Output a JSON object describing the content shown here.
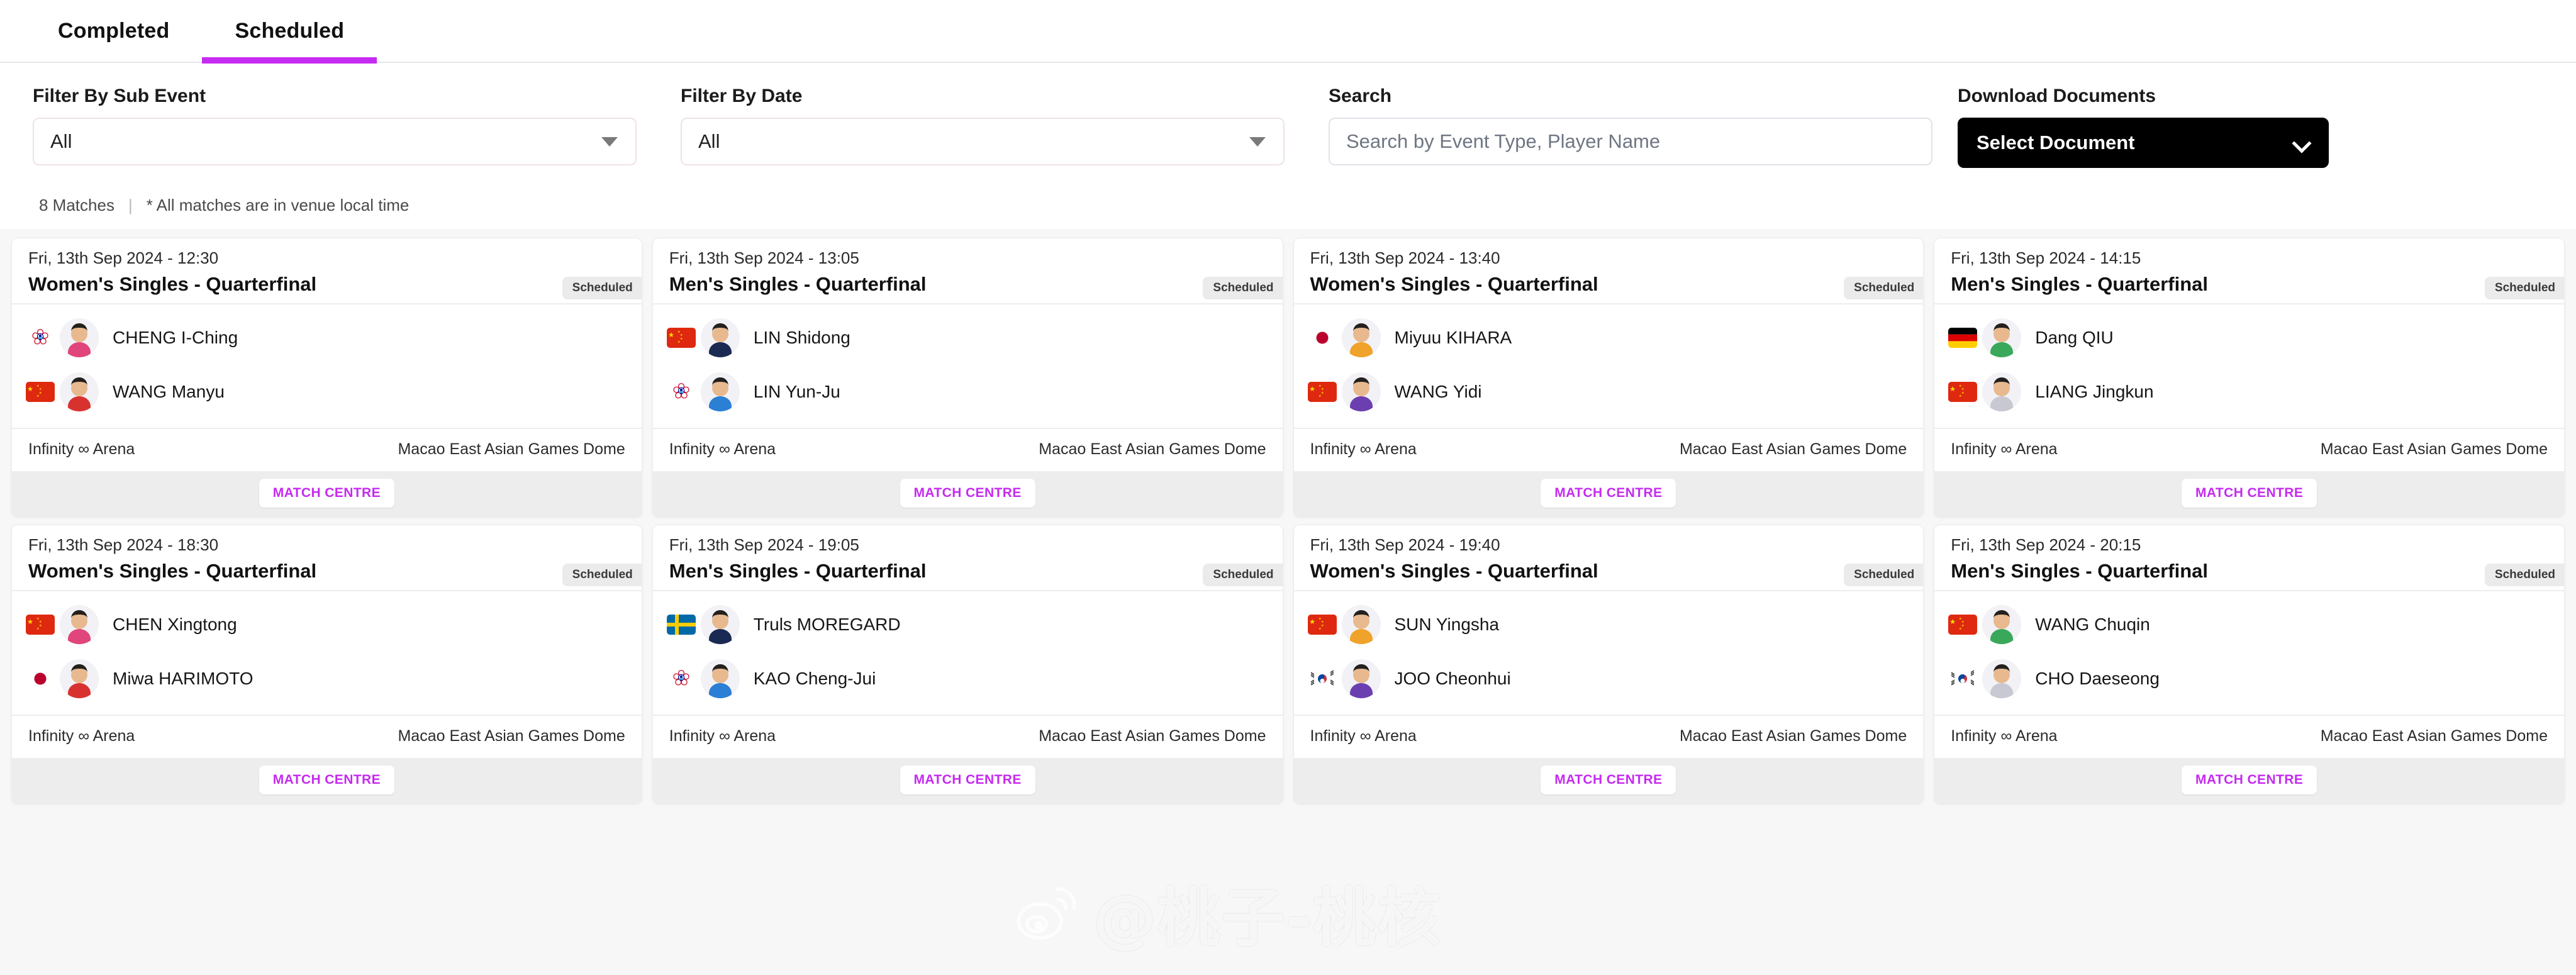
{
  "tabs": [
    {
      "label": "Completed",
      "active": false
    },
    {
      "label": "Scheduled",
      "active": true
    }
  ],
  "filters": {
    "sub_event": {
      "label": "Filter By Sub Event",
      "value": "All",
      "icon": "chevron-down-icon"
    },
    "date": {
      "label": "Filter By Date",
      "value": "All",
      "icon": "chevron-down-icon"
    },
    "search": {
      "label": "Search",
      "value": "",
      "placeholder": "Search by Event Type, Player Name"
    },
    "download": {
      "label": "Download Documents",
      "value": "Select Document",
      "icon": "chevron-down-icon"
    }
  },
  "meta": {
    "count": "8 Matches",
    "divider": "|",
    "note": "* All matches are in venue local time"
  },
  "card_labels": {
    "status": "Scheduled",
    "match_centre": "MATCH CENTRE"
  },
  "colors": {
    "accent": "#c52bf0",
    "badge_bg": "#ebebeb",
    "doc_button_bg": "#000000",
    "footer_bg": "#ededed"
  },
  "watermark": {
    "icon": "weibo-logo-icon",
    "text": "@桃子-桃核"
  },
  "matches": [
    {
      "date": "Fri, 13th Sep 2024 - 12:30",
      "title": "Women's Singles - Quarterfinal",
      "status": "Scheduled",
      "venue_hall": "Infinity ∞ Arena",
      "venue_name": "Macao East Asian Games Dome",
      "players": [
        {
          "name": "CHENG I-Ching",
          "flag": "TPE",
          "flag_icon": "flag-chinese-taipei-icon"
        },
        {
          "name": "WANG Manyu",
          "flag": "CHN",
          "flag_icon": "flag-china-icon"
        }
      ]
    },
    {
      "date": "Fri, 13th Sep 2024 - 13:05",
      "title": "Men's Singles - Quarterfinal",
      "status": "Scheduled",
      "venue_hall": "Infinity ∞ Arena",
      "venue_name": "Macao East Asian Games Dome",
      "players": [
        {
          "name": "LIN Shidong",
          "flag": "CHN",
          "flag_icon": "flag-china-icon"
        },
        {
          "name": "LIN Yun-Ju",
          "flag": "TPE",
          "flag_icon": "flag-chinese-taipei-icon"
        }
      ]
    },
    {
      "date": "Fri, 13th Sep 2024 - 13:40",
      "title": "Women's Singles - Quarterfinal",
      "status": "Scheduled",
      "venue_hall": "Infinity ∞ Arena",
      "venue_name": "Macao East Asian Games Dome",
      "players": [
        {
          "name": "Miyuu KIHARA",
          "flag": "JPN",
          "flag_icon": "flag-japan-icon"
        },
        {
          "name": "WANG Yidi",
          "flag": "CHN",
          "flag_icon": "flag-china-icon"
        }
      ]
    },
    {
      "date": "Fri, 13th Sep 2024 - 14:15",
      "title": "Men's Singles - Quarterfinal",
      "status": "Scheduled",
      "venue_hall": "Infinity ∞ Arena",
      "venue_name": "Macao East Asian Games Dome",
      "players": [
        {
          "name": "Dang QIU",
          "flag": "GER",
          "flag_icon": "flag-germany-icon"
        },
        {
          "name": "LIANG Jingkun",
          "flag": "CHN",
          "flag_icon": "flag-china-icon"
        }
      ]
    },
    {
      "date": "Fri, 13th Sep 2024 - 18:30",
      "title": "Women's Singles - Quarterfinal",
      "status": "Scheduled",
      "venue_hall": "Infinity ∞ Arena",
      "venue_name": "Macao East Asian Games Dome",
      "players": [
        {
          "name": "CHEN Xingtong",
          "flag": "CHN",
          "flag_icon": "flag-china-icon"
        },
        {
          "name": "Miwa HARIMOTO",
          "flag": "JPN",
          "flag_icon": "flag-japan-icon"
        }
      ]
    },
    {
      "date": "Fri, 13th Sep 2024 - 19:05",
      "title": "Men's Singles - Quarterfinal",
      "status": "Scheduled",
      "venue_hall": "Infinity ∞ Arena",
      "venue_name": "Macao East Asian Games Dome",
      "players": [
        {
          "name": "Truls MOREGARD",
          "flag": "SWE",
          "flag_icon": "flag-sweden-icon"
        },
        {
          "name": "KAO Cheng-Jui",
          "flag": "TPE",
          "flag_icon": "flag-chinese-taipei-icon"
        }
      ]
    },
    {
      "date": "Fri, 13th Sep 2024 - 19:40",
      "title": "Women's Singles - Quarterfinal",
      "status": "Scheduled",
      "venue_hall": "Infinity ∞ Arena",
      "venue_name": "Macao East Asian Games Dome",
      "players": [
        {
          "name": "SUN Yingsha",
          "flag": "CHN",
          "flag_icon": "flag-china-icon"
        },
        {
          "name": "JOO Cheonhui",
          "flag": "KOR",
          "flag_icon": "flag-south-korea-icon"
        }
      ]
    },
    {
      "date": "Fri, 13th Sep 2024 - 20:15",
      "title": "Men's Singles - Quarterfinal",
      "status": "Scheduled",
      "venue_hall": "Infinity ∞ Arena",
      "venue_name": "Macao East Asian Games Dome",
      "players": [
        {
          "name": "WANG Chuqin",
          "flag": "CHN",
          "flag_icon": "flag-china-icon"
        },
        {
          "name": "CHO Daeseong",
          "flag": "KOR",
          "flag_icon": "flag-south-korea-icon"
        }
      ]
    }
  ]
}
